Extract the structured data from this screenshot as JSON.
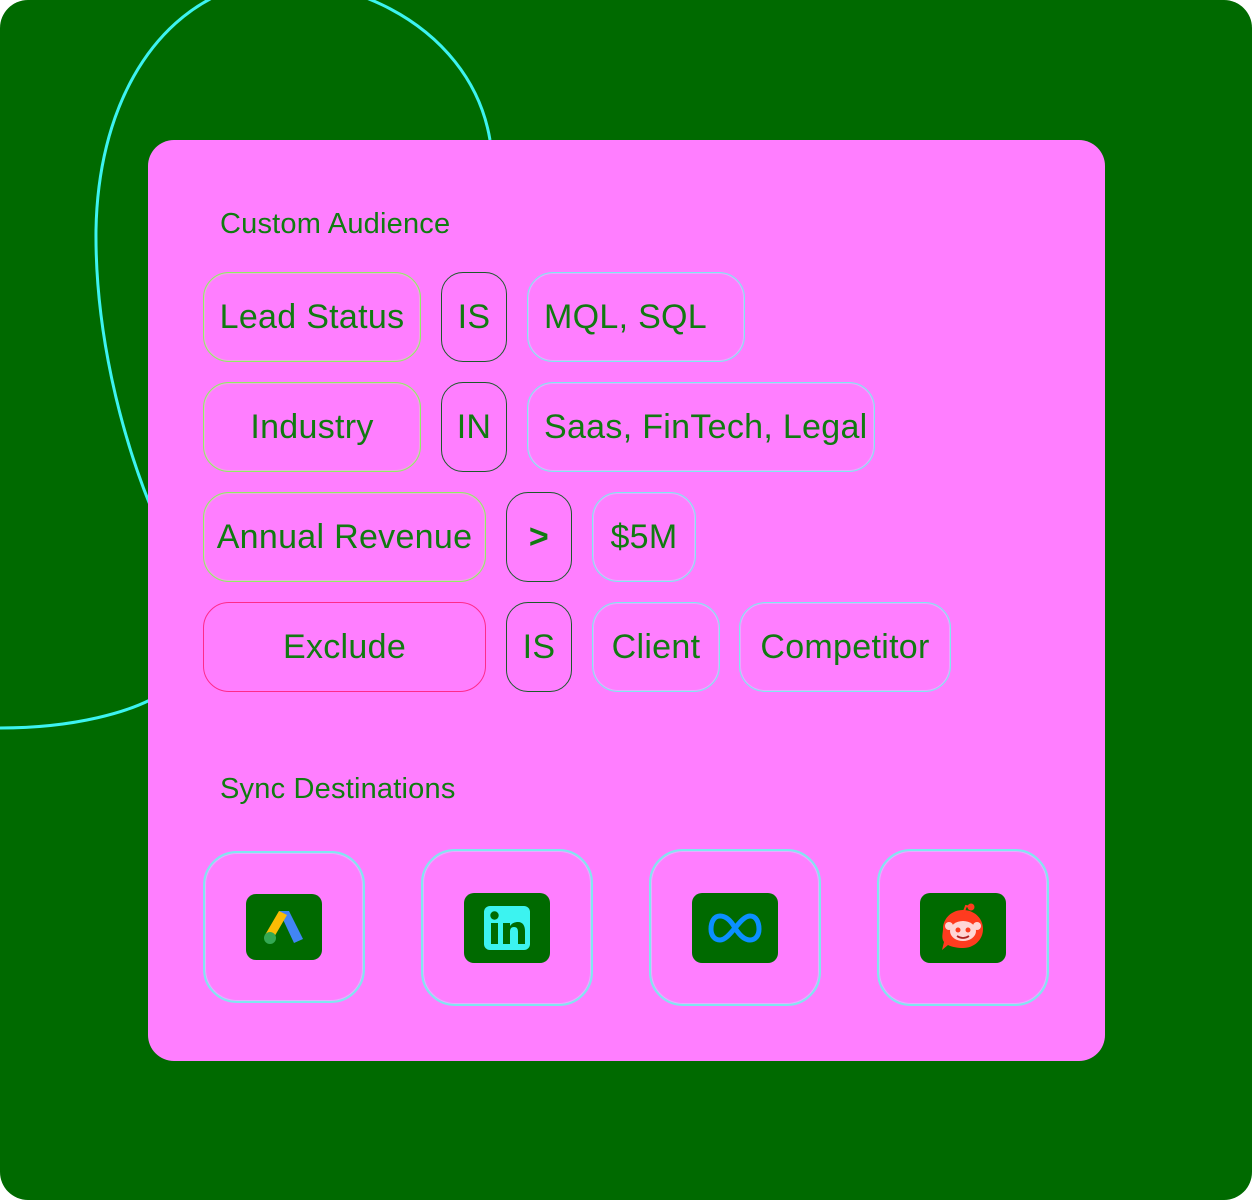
{
  "audience": {
    "title": "Custom Audience",
    "rules": [
      {
        "field": "Lead Status",
        "operator": "IS",
        "values": [
          "MQL, SQL"
        ]
      },
      {
        "field": "Industry",
        "operator": "IN",
        "values": [
          "Saas, FinTech, Legal"
        ]
      },
      {
        "field": "Annual Revenue",
        "operator": ">",
        "values": [
          "$5M"
        ]
      },
      {
        "field": "Exclude",
        "operator": "IS",
        "values": [
          "Client",
          "Competitor"
        ]
      }
    ]
  },
  "sync": {
    "title": "Sync Destinations",
    "destinations": [
      {
        "icon": "google-ads-icon"
      },
      {
        "icon": "linkedin-icon"
      },
      {
        "icon": "meta-icon"
      },
      {
        "icon": "reddit-icon"
      }
    ]
  },
  "colors": {
    "background": "#006a00",
    "card": "#ff7eff",
    "text": "#117a11",
    "field_border": "#90ee64",
    "value_border": "#7fe7f0",
    "exclude_border": "#ff2a8a",
    "curve": "#3cf3f0"
  }
}
